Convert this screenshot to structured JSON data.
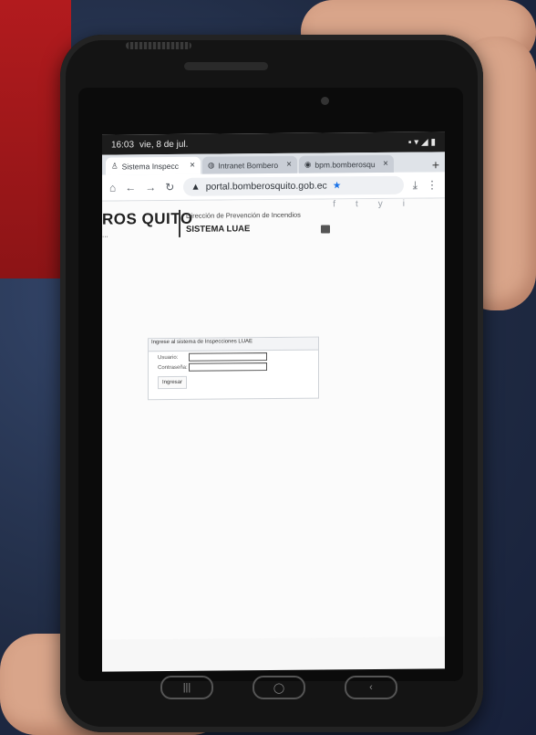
{
  "status_bar": {
    "time": "16:03",
    "date": "vie, 8 de jul.",
    "indicators": "▪ ▾ ◢ ▮"
  },
  "tabs": [
    {
      "label": "Sistema Inspecc",
      "active": true,
      "icon": "person-icon"
    },
    {
      "label": "Intranet Bombero",
      "active": false,
      "icon": "globe-icon"
    },
    {
      "label": "bpm.bomberosqu",
      "active": false,
      "icon": "chrome-icon"
    }
  ],
  "address_bar": {
    "url": "portal.bomberosquito.gob.ec"
  },
  "page": {
    "brand": "ROS QUITO",
    "brand_sub": "...",
    "department": "Dirección de Prevención de Incendios",
    "system": "SISTEMA LUAE",
    "socials": [
      "f",
      "t",
      "y",
      "i"
    ]
  },
  "login": {
    "title": "Ingrese al sistema de Inspecciones LUAE",
    "user_label": "Usuario:",
    "password_label": "Contraseña:",
    "submit_label": "Ingresar"
  },
  "colors": {
    "accent_red": "#b21b1e",
    "link_blue": "#1a73e8"
  }
}
